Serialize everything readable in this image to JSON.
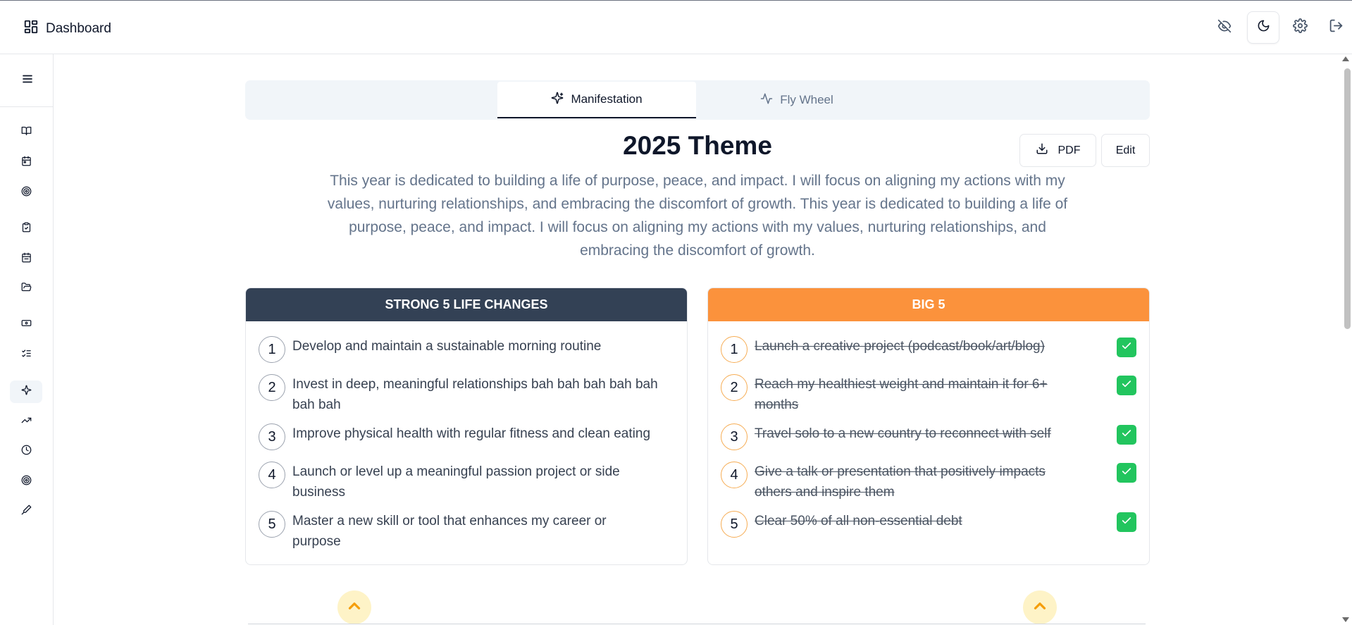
{
  "header": {
    "title": "Dashboard",
    "icons": [
      "layout-grid-icon",
      "eye-off-icon",
      "moon-icon",
      "gear-icon",
      "logout-icon"
    ]
  },
  "sidebar": {
    "items": [
      {
        "icon": "book-open-icon"
      },
      {
        "icon": "calendar-icon"
      },
      {
        "icon": "target-icon"
      },
      {
        "icon": "clipboard-check-icon"
      },
      {
        "icon": "calendar-days-icon"
      },
      {
        "icon": "folder-open-icon"
      },
      {
        "icon": "ticket-icon"
      },
      {
        "icon": "list-checks-icon"
      },
      {
        "icon": "sparkles-icon",
        "active": true
      },
      {
        "icon": "trending-up-icon"
      },
      {
        "icon": "clock-icon"
      },
      {
        "icon": "target-icon"
      },
      {
        "icon": "pen-tool-icon"
      }
    ]
  },
  "tabs": [
    {
      "label": "Manifestation",
      "icon": "sparkles-icon",
      "active": true
    },
    {
      "label": "Fly Wheel",
      "icon": "activity-icon",
      "active": false
    }
  ],
  "theme": {
    "title": "2025 Theme",
    "description": "This year is dedicated to building a life of purpose, peace, and impact. I will focus on aligning my actions with my values, nurturing relationships, and embracing the discomfort of growth. This year is dedicated to building a life of purpose, peace, and impact. I will focus on aligning my actions with my values, nurturing relationships, and embracing the discomfort of growth.",
    "pdf_label": "PDF",
    "edit_label": "Edit"
  },
  "strong5": {
    "title": "STRONG 5 LIFE CHANGES",
    "color": "#334155",
    "items": [
      {
        "n": "1",
        "text": "Develop and maintain a sustainable morning routine"
      },
      {
        "n": "2",
        "text": "Invest in deep, meaningful relationships bah bah bah bah bah bah bah"
      },
      {
        "n": "3",
        "text": "Improve physical health with regular fitness and clean eating"
      },
      {
        "n": "4",
        "text": "Launch or level up a meaningful passion project or side business"
      },
      {
        "n": "5",
        "text": "Master a new skill or tool that enhances my career or purpose"
      }
    ]
  },
  "big5": {
    "title": "BIG 5",
    "color": "#fb923c",
    "items": [
      {
        "n": "1",
        "text": "Launch a creative project (podcast/book/art/blog)",
        "done": true
      },
      {
        "n": "2",
        "text": "Reach my healthiest weight and maintain it for 6+ months",
        "done": true
      },
      {
        "n": "3",
        "text": "Travel solo to a new country to reconnect with self",
        "done": true
      },
      {
        "n": "4",
        "text": "Give a talk or presentation that positively impacts others and inspire them",
        "done": true
      },
      {
        "n": "5",
        "text": "Clear 50% of all non-essential debt",
        "done": true
      }
    ]
  },
  "colors": {
    "accent": "#f59e0b",
    "check": "#22c55e"
  }
}
